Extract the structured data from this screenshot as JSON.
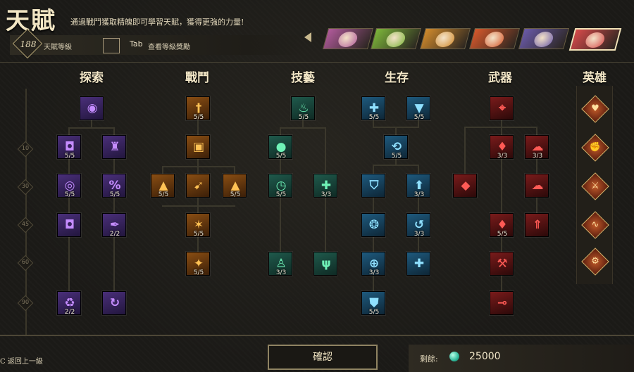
{
  "header": {
    "title": "天賦",
    "description": "通過戰鬥獲取精魄即可學習天賦，獲得更強的力量!",
    "talent_level": "188",
    "talent_level_label": "天賦等級",
    "tab_key": "Tab",
    "tab_hint": "查看等級獎勵"
  },
  "heroes": [
    {
      "name": "hero-portrait-1",
      "color": "#b05a9a"
    },
    {
      "name": "hero-portrait-2",
      "color": "#7cb53a"
    },
    {
      "name": "hero-portrait-3",
      "color": "#d18a2c"
    },
    {
      "name": "hero-portrait-4",
      "color": "#d5582c"
    },
    {
      "name": "hero-portrait-5",
      "color": "#6a5aa8"
    },
    {
      "name": "hero-portrait-6",
      "color": "#d64a4a",
      "selected": true
    }
  ],
  "categories": {
    "explore": "探索",
    "combat": "戰鬥",
    "skill": "技藝",
    "survival": "生存",
    "weapon": "武器",
    "hero": "英雄"
  },
  "level_markers": [
    "10",
    "30",
    "45",
    "60",
    "90"
  ],
  "nodes": {
    "ex1": "",
    "ex2": "5/5",
    "ex3": "",
    "ex4": "5/5",
    "ex5": "5/5",
    "ex6": "",
    "ex7": "2/2",
    "ex8": "2/2",
    "ex9": "",
    "co1": "5/5",
    "co2": "",
    "co3": "5/5",
    "co4": "",
    "co5": "5/5",
    "co6": "5/5",
    "co7": "5/5",
    "sk1": "5/5",
    "sk2": "5/5",
    "sk3": "5/5",
    "sk4": "3/3",
    "sk5": "3/3",
    "sk6": "",
    "su1": "5/5",
    "su2": "5/5",
    "su3": "5/5",
    "su4": "",
    "su5": "3/3",
    "su6": "",
    "su7": "3/3",
    "su8": "3/3",
    "su9": "",
    "su10": "5/5",
    "we1": "",
    "we2": "3/3",
    "we3": "3/3",
    "we4": "",
    "we5": "",
    "we6": "5/5",
    "we7": "",
    "we8": "",
    "we9": ""
  },
  "footer": {
    "back_label": "C 返回上一級",
    "confirm_label": "確認",
    "remaining_label": "剩餘:",
    "remaining_value": "25000"
  }
}
